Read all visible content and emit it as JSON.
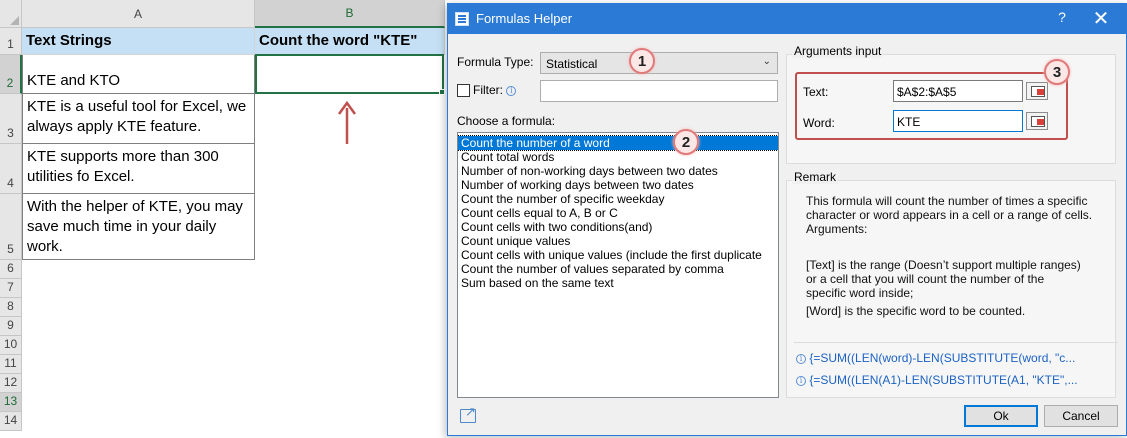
{
  "spreadsheet": {
    "columns": [
      "A",
      "B"
    ],
    "rows": [
      "1",
      "2",
      "3",
      "4",
      "5",
      "6",
      "7",
      "8",
      "9",
      "10",
      "11",
      "12",
      "13",
      "14"
    ],
    "a1": "Text Strings",
    "b1": "Count the word \"KTE\"",
    "a2": "KTE and KTO",
    "a3_lines": [
      "KTE is a useful tool for Excel, we",
      "always apply KTE feature."
    ],
    "a4_lines": [
      "KTE supports more than 300",
      "utilities fo Excel."
    ],
    "a5_lines": [
      "With the helper of KTE, you may",
      "save much time in your daily",
      "work."
    ],
    "b2": ""
  },
  "dialog": {
    "title": "Formulas Helper",
    "help": "?",
    "close": "✕",
    "formula_type_label": "Formula Type:",
    "formula_type_value": "Statistical",
    "filter_label": "Filter:",
    "filter_value": "",
    "choose_label": "Choose a formula:",
    "formulas": [
      "Count the number of a word",
      "Count total words",
      "Number of non-working days between two dates",
      "Number of working days between two dates",
      "Count the number of specific weekday",
      "Count cells equal to A, B or C",
      "Count cells with two conditions(and)",
      "Count unique values",
      "Count cells with unique values (include the first duplicate",
      "Count the number of values separated by comma",
      "Sum based on the same text"
    ],
    "selected_formula": "Count the number of a word",
    "arguments_title": "Arguments input",
    "text_label": "Text:",
    "text_value": "$A$2:$A$5",
    "word_label": "Word:",
    "word_value": "KTE",
    "remark_title": "Remark",
    "remark_lines": [
      "This formula will count the number of times a specific",
      "character or word appears in a cell or a range of cells.",
      "Arguments:",
      "",
      "[Text] is the range (Doesn’t support multiple ranges)",
      "or a cell that you will count the number of the",
      "specific word inside;",
      "[Word] is the specific word to be counted."
    ],
    "formula_1": "{=SUM((LEN(word)-LEN(SUBSTITUTE(word, \"c...",
    "formula_2": "{=SUM((LEN(A1)-LEN(SUBSTITUTE(A1, \"KTE\",...",
    "ok_label": "Ok",
    "cancel_label": "Cancel"
  },
  "callouts": [
    "1",
    "2",
    "3"
  ],
  "colors": {
    "accent": "#2b7bd6",
    "header_fill": "#c5e0f5",
    "excel_green": "#217346",
    "callout_border": "#e07a7a",
    "arrow": "#c0504d"
  }
}
